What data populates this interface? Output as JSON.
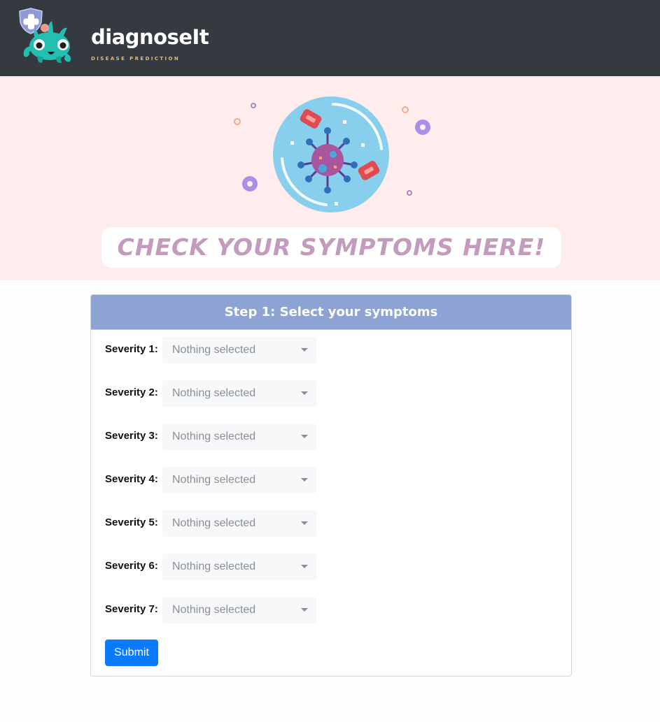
{
  "header": {
    "app_name": "diagnoseIt",
    "tagline": "DISEASE PREDICTION"
  },
  "hero": {
    "banner_text": "CHECK YOUR SYMPTOMS HERE!"
  },
  "form": {
    "title": "Step 1: Select your symptoms",
    "rows": [
      {
        "label": "Severity 1:",
        "value": "Nothing selected"
      },
      {
        "label": "Severity 2:",
        "value": "Nothing selected"
      },
      {
        "label": "Severity 3:",
        "value": "Nothing selected"
      },
      {
        "label": "Severity 4:",
        "value": "Nothing selected"
      },
      {
        "label": "Severity 5:",
        "value": "Nothing selected"
      },
      {
        "label": "Severity 6:",
        "value": "Nothing selected"
      },
      {
        "label": "Severity 7:",
        "value": "Nothing selected"
      }
    ],
    "submit_label": "Submit"
  },
  "icons": {
    "logo": "monster-shield-logo-icon",
    "hero": "virus-illustration-icon",
    "dropdown": "caret-down-icon"
  },
  "colors": {
    "topbar": "#343a40",
    "hero_bg": "#ffecec",
    "card_header": "#8da3d4",
    "banner_text": "#c39bbd",
    "submit": "#0a7bff"
  }
}
